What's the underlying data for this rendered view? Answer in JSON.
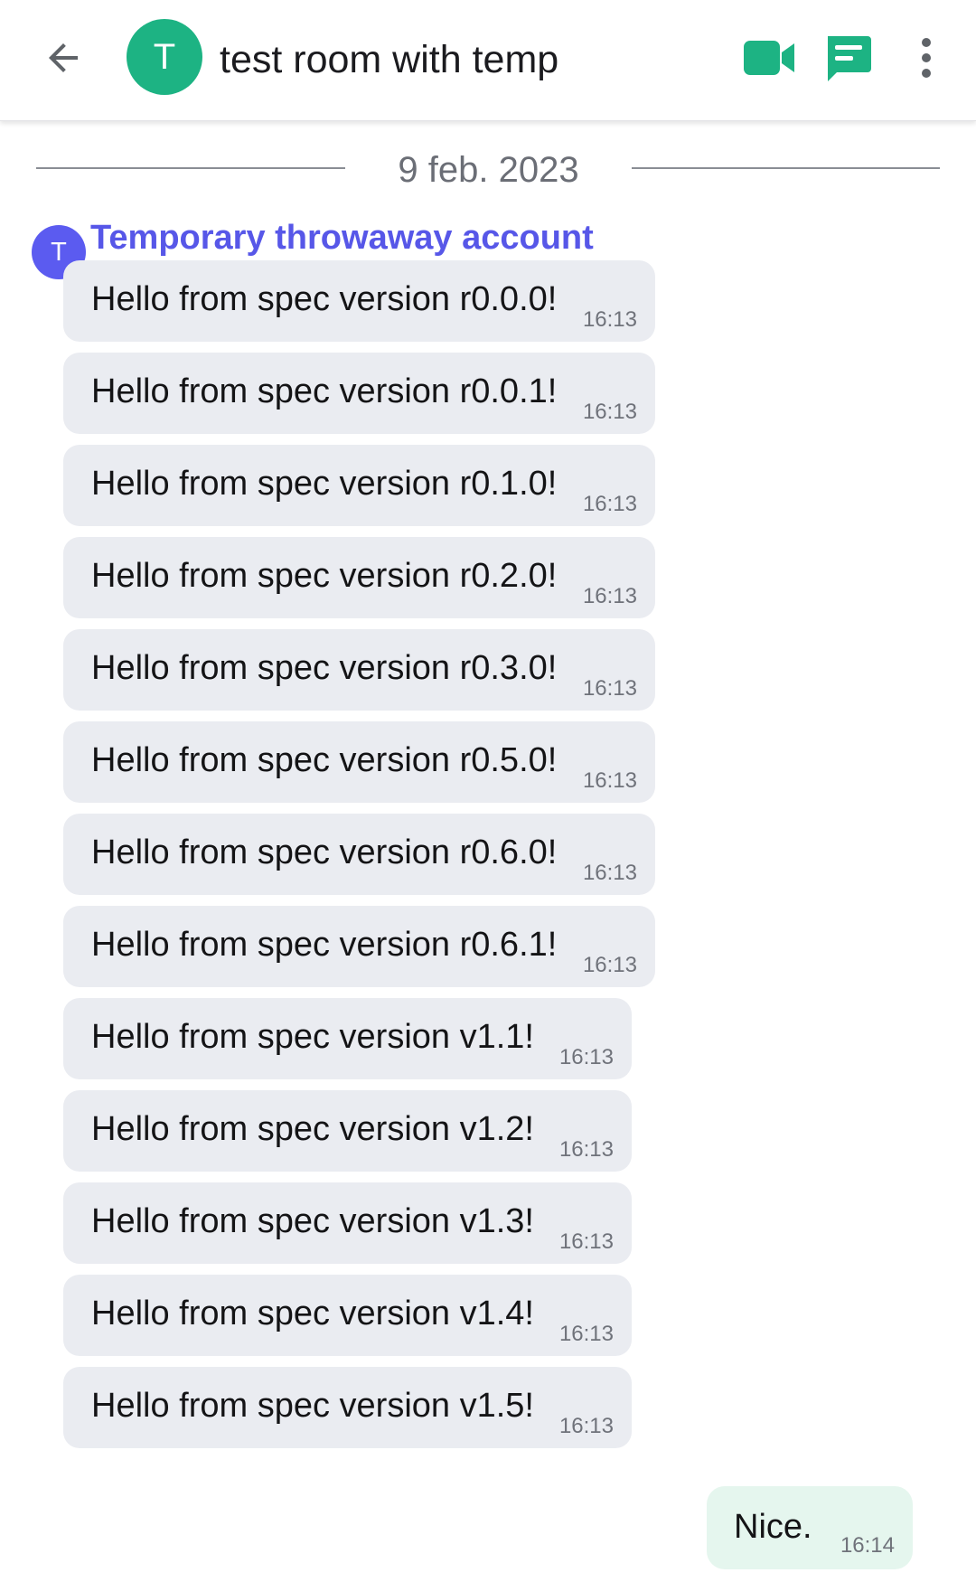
{
  "header": {
    "room_initial": "T",
    "room_name": "test room with temp",
    "icons": {
      "back": "arrow-left-icon",
      "video": "video-camera-icon",
      "threads": "chat-threads-icon",
      "more": "more-vertical-icon"
    }
  },
  "colors": {
    "accent": "#1db383",
    "sender": "#5b5bf0",
    "incoming_bubble": "#eaecf1",
    "outgoing_bubble": "#e5f6ee"
  },
  "timeline": {
    "date_separator": "9 feb. 2023",
    "sender": {
      "initial": "T",
      "name": "Temporary throwaway account"
    },
    "messages": [
      {
        "text": "Hello from spec version r0.0.0!",
        "time": "16:13"
      },
      {
        "text": "Hello from spec version r0.0.1!",
        "time": "16:13"
      },
      {
        "text": "Hello from spec version r0.1.0!",
        "time": "16:13"
      },
      {
        "text": "Hello from spec version r0.2.0!",
        "time": "16:13"
      },
      {
        "text": "Hello from spec version r0.3.0!",
        "time": "16:13"
      },
      {
        "text": "Hello from spec version r0.5.0!",
        "time": "16:13"
      },
      {
        "text": "Hello from spec version r0.6.0!",
        "time": "16:13"
      },
      {
        "text": "Hello from spec version r0.6.1!",
        "time": "16:13"
      },
      {
        "text": "Hello from spec version v1.1!",
        "time": "16:13"
      },
      {
        "text": "Hello from spec version v1.2!",
        "time": "16:13"
      },
      {
        "text": "Hello from spec version v1.3!",
        "time": "16:13"
      },
      {
        "text": "Hello from spec version v1.4!",
        "time": "16:13"
      },
      {
        "text": "Hello from spec version v1.5!",
        "time": "16:13"
      }
    ],
    "own_message": {
      "text": "Nice.",
      "time": "16:14"
    }
  }
}
